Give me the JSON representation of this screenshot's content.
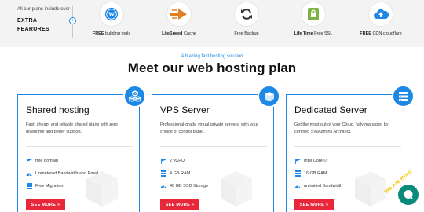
{
  "features": {
    "intro_small": "All our plans include over",
    "intro_big": "EXTRA FEARURES",
    "items": [
      {
        "bold": "FREE",
        "rest": " building tools",
        "icon": "wordpress-icon",
        "color": "#1e88e5"
      },
      {
        "bold": "LiteSpeed",
        "rest": " Cache",
        "icon": "litespeed-icon",
        "color": "#e67e22"
      },
      {
        "bold": "",
        "rest": "Free Backup",
        "icon": "refresh-icon",
        "color": "#333333"
      },
      {
        "bold": "Life Time",
        "rest": " Free SSL",
        "icon": "ssl-lock-icon",
        "color": "#7cb342"
      },
      {
        "bold": "FREE",
        "rest": " CDN cloudflare",
        "icon": "cloud-upload-icon",
        "color": "#1e88e5"
      }
    ]
  },
  "section": {
    "kicker": "A blazing fast hosting solution",
    "title": "Meet our web hosting plan"
  },
  "plans": [
    {
      "name": "Shared hosting",
      "icon": "cubes-icon",
      "desc": "Fast, cheap, and reliable shared plans with zero downtime and better support.",
      "features": [
        {
          "icon": "flag-icon",
          "text": "free domain"
        },
        {
          "icon": "speedometer-icon",
          "text": "Unmetered Bandwidth and Email"
        },
        {
          "icon": "server-icon",
          "text": "Free Migration"
        }
      ],
      "button": "SEE MORE »"
    },
    {
      "name": "VPS Server",
      "icon": "cube-icon",
      "desc": "Professional-grade virtual private servers, with your choice of control panel.",
      "features": [
        {
          "icon": "flag-icon",
          "text": "2 vCPU"
        },
        {
          "icon": "server-icon",
          "text": "4 GB RAM"
        },
        {
          "icon": "speedometer-icon",
          "text": "40 GB SSD Storage"
        }
      ],
      "button": "SEE MORE »"
    },
    {
      "name": "Dedicated Server",
      "icon": "server-rack-icon",
      "desc": "Get the most out of your Cloud, fully managed by certified SysAdmins Architect.",
      "features": [
        {
          "icon": "flag-icon",
          "text": "Intel Core i7"
        },
        {
          "icon": "server-icon",
          "text": "16 GB RAM"
        },
        {
          "icon": "speedometer-icon",
          "text": "unlimited Bandwidth"
        }
      ],
      "button": "SEE MORE »"
    }
  ],
  "chat": {
    "tag": "We Are Here!",
    "color": "#0a8a7a"
  },
  "colors": {
    "accent": "#1e88e5",
    "button": "#e8283a"
  }
}
